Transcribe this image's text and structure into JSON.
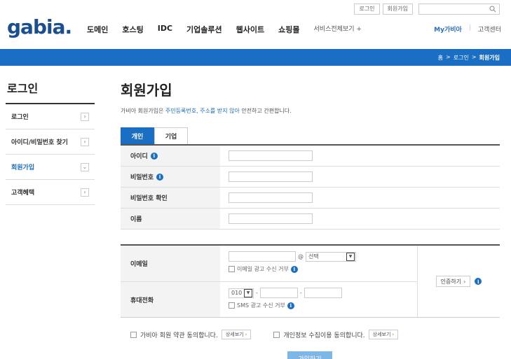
{
  "util": {
    "login": "로그인",
    "signup": "회원가입"
  },
  "logo": "gabia.",
  "gnb": [
    "도메인",
    "호스팅",
    "IDC",
    "기업솔루션",
    "웹사이트",
    "쇼핑몰"
  ],
  "gnb_more": "서비스전체보기 +",
  "header_right": {
    "my": "My가비아",
    "sep": "|",
    "cs": "고객센터"
  },
  "breadcrumb": {
    "home": "홈",
    "sep": ">",
    "c1": "로그인",
    "c2": "회원가입"
  },
  "sidebar": {
    "title": "로그인",
    "items": [
      {
        "label": "로그인",
        "arrow": "›",
        "active": false
      },
      {
        "label": "아이디/비밀번호 찾기",
        "arrow": "›",
        "active": false
      },
      {
        "label": "회원가입",
        "arrow": "⌄",
        "active": true
      },
      {
        "label": "고객혜택",
        "arrow": "›",
        "active": false
      }
    ]
  },
  "main": {
    "title": "회원가입",
    "intro_pre": "가비아 회원가입은 ",
    "intro_hl": "주민등록번호, 주소를 받지 않아",
    "intro_post": " 안전하고 간편합니다."
  },
  "tabs": [
    {
      "label": "개인",
      "active": true
    },
    {
      "label": "기업",
      "active": false
    }
  ],
  "form1": [
    {
      "label": "아이디",
      "info": true
    },
    {
      "label": "비밀번호",
      "info": true
    },
    {
      "label": "비밀번호 확인",
      "info": false
    },
    {
      "label": "이름",
      "info": false
    }
  ],
  "email": {
    "label": "이메일",
    "at": "@",
    "select": "선택",
    "opt_out": "이메일 광고 수신 거부"
  },
  "phone": {
    "label": "휴대전화",
    "prefix": "010",
    "dash": "-",
    "opt_out": "SMS 광고 수신 거부"
  },
  "auth": {
    "label": "인증하기",
    "arrow": "›"
  },
  "agree": {
    "terms": "가비아 회원 약관 동의합니다.",
    "privacy": "개인정보 수집이용 동의합니다.",
    "detail": "상세보기",
    "arrow": "›"
  },
  "submit": "가입하기",
  "info_glyph": "i",
  "colors": {
    "brand": "#1a6fc4",
    "logo": "#1a4f8f"
  }
}
